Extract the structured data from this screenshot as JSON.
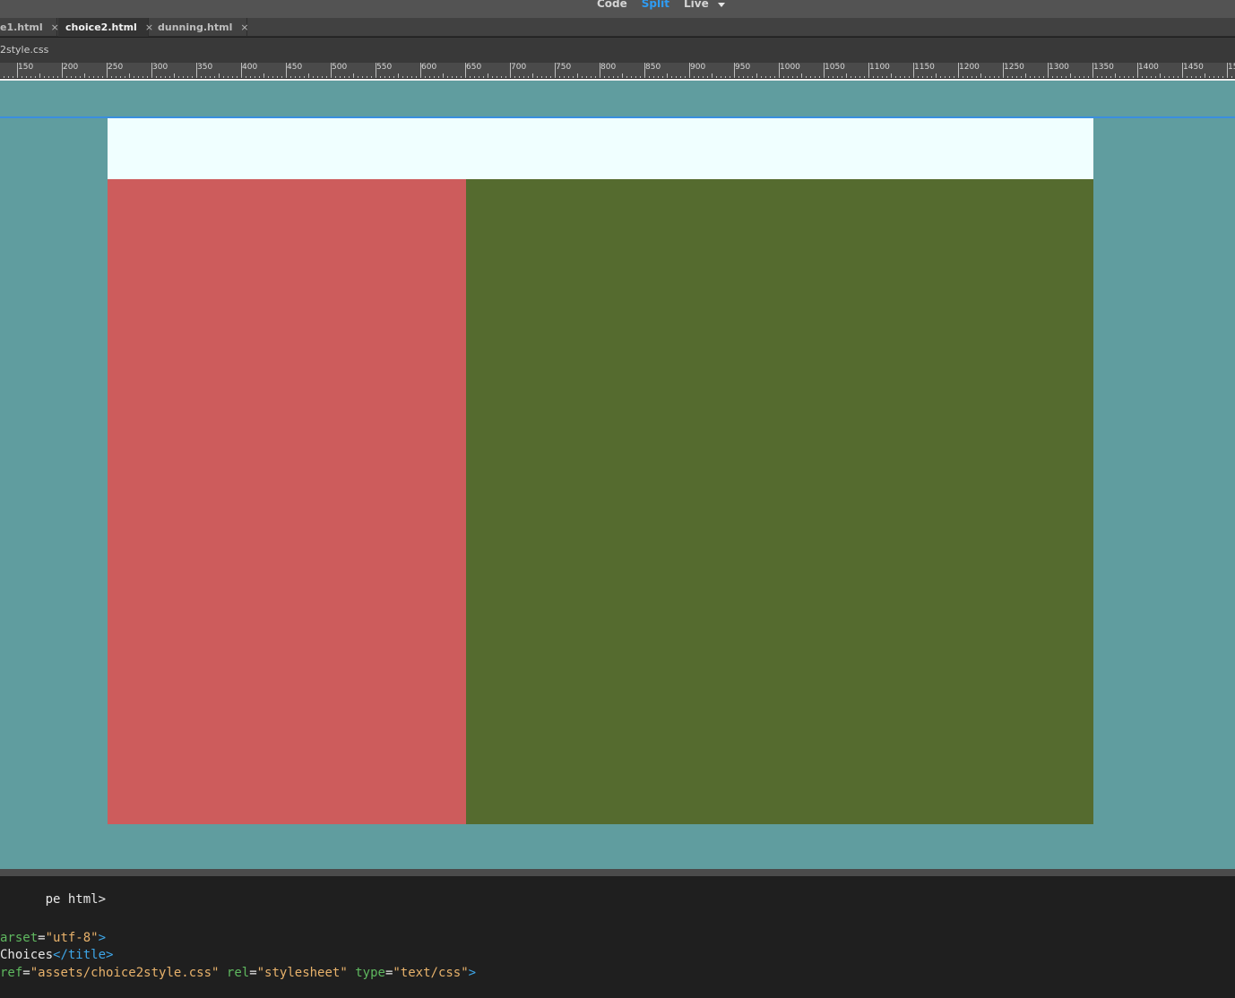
{
  "view_switcher": {
    "code_label": "Code",
    "split_label": "Split",
    "live_label": "Live"
  },
  "tabs": [
    {
      "label": "e1.html",
      "active": false
    },
    {
      "label": "choice2.html",
      "active": true
    },
    {
      "label": "dunning.html",
      "active": false
    }
  ],
  "tab_close_glyph": "×",
  "related_files": {
    "file": "2style.css"
  },
  "ruler": {
    "labels": [
      "150",
      "200",
      "250",
      "300",
      "350",
      "400",
      "450",
      "500",
      "550",
      "600",
      "650",
      "700",
      "750",
      "800",
      "850",
      "900",
      "950",
      "1000",
      "1050",
      "1100",
      "1150",
      "1200",
      "1250",
      "1300",
      "1350",
      "1400",
      "1450",
      "15"
    ]
  },
  "canvas": {
    "colors": {
      "background": "#609d9f",
      "header": "#f0ffff",
      "left_panel": "#cd5c5c",
      "right_panel": "#556b2f",
      "guide": "#3a8ee0"
    }
  },
  "code": {
    "line1": "pe html>",
    "line2_attr": "arset",
    "line2_eq": "=",
    "line2_val": "\"utf-8\"",
    "line2_close": ">",
    "line3_text": "Choices",
    "line3_tag": "</title>",
    "line4_attr1": "ref",
    "line4_eq1": "=",
    "line4_val1": "\"assets/choice2style.css\"",
    "line4_attr2": "rel",
    "line4_eq2": "=",
    "line4_val2": "\"stylesheet\"",
    "line4_attr3": "type",
    "line4_eq3": "=",
    "line4_val3": "\"text/css\"",
    "line4_close": ">"
  }
}
